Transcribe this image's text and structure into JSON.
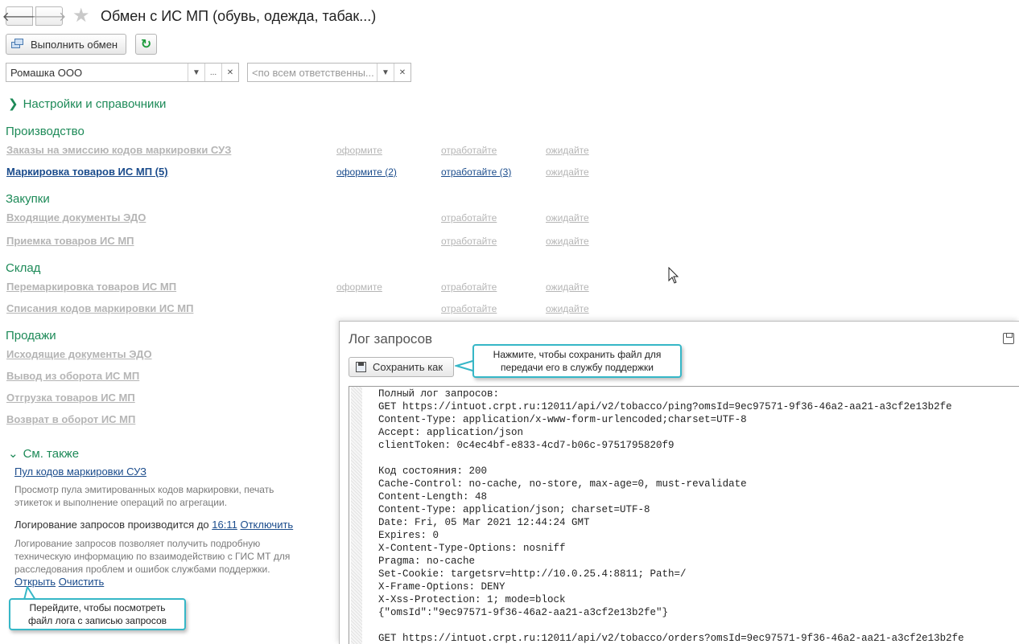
{
  "header": {
    "back_icon": "arrow-left-icon",
    "forward_icon": "arrow-right-icon",
    "favorite_icon": "star-icon",
    "title": "Обмен с ИС МП (обувь, одежда, табак...)"
  },
  "toolbar": {
    "exec_label": "Выполнить обмен",
    "refresh_icon": "refresh-icon"
  },
  "filters": {
    "organization": "Ромашка ООО",
    "responsible_placeholder": "<по всем ответственны...",
    "dots": "..."
  },
  "settings_link": "Настройки и справочники",
  "groups": {
    "production": {
      "title": "Производство",
      "rows": [
        {
          "label": "Заказы на эмиссию кодов маркировки СУЗ",
          "a1": "оформите",
          "a2": "отработайте",
          "a3": "ожидайте"
        },
        {
          "label": "Маркировка товаров ИС МП (5)",
          "a1": "оформите (2)",
          "a2": "отработайте (3)",
          "a3": "ожидайте"
        }
      ]
    },
    "purchases": {
      "title": "Закупки",
      "rows": [
        {
          "label": "Входящие документы ЭДО",
          "a2": "отработайте",
          "a3": "ожидайте"
        },
        {
          "label": "Приемка товаров ИС МП",
          "a2": "отработайте",
          "a3": "ожидайте"
        }
      ]
    },
    "warehouse": {
      "title": "Склад",
      "rows": [
        {
          "label": "Перемаркировка товаров ИС МП",
          "a1": "оформите",
          "a2": "отработайте",
          "a3": "ожидайте"
        },
        {
          "label": "Списания кодов маркировки ИС МП",
          "a2": "отработайте",
          "a3": "ожидайте"
        }
      ]
    },
    "sales": {
      "title": "Продажи",
      "rows": [
        {
          "label": "Исходящие документы ЭДО"
        },
        {
          "label": "Вывод из оборота ИС МП"
        },
        {
          "label": "Отгрузка товаров ИС МП"
        },
        {
          "label": "Возврат в оборот ИС МП"
        }
      ]
    }
  },
  "see_also": {
    "title": "См. также",
    "pool_link": "Пул кодов маркировки СУЗ",
    "pool_desc": [
      "Просмотр пула эмитированных кодов маркировки, печать",
      "этикеток и выполнение операций по агрегации."
    ],
    "logging_text": "Логирование запросов производится до",
    "logging_time": "16:11",
    "disable_link": "Отключить",
    "logging_desc": [
      "Логирование запросов позволяет получить подробную",
      "техническую информацию по взаимодействию с ГИС МТ для",
      "расследования проблем и ошибок службами поддержки."
    ],
    "open_link": "Открыть",
    "clear_link": "Очистить"
  },
  "callouts": {
    "left": [
      "Перейдите, чтобы посмотреть",
      "файл лога с записью запросов"
    ],
    "right": [
      "Нажмите, чтобы сохранить файл для",
      "передачи его в службу поддержки"
    ]
  },
  "log_window": {
    "title": "Лог запросов",
    "save_icon": "floppy-disk-icon",
    "save_as_label": "Сохранить как",
    "lines": [
      "Полный лог запросов:",
      "GET https://intuot.crpt.ru:12011/api/v2/tobacco/ping?omsId=9ec97571-9f36-46a2-aa21-a3cf2e13b2fe",
      "Content-Type: application/x-www-form-urlencoded;charset=UTF-8",
      "Accept: application/json",
      "clientToken: 0c4ec4bf-e833-4cd7-b06c-9751795820f9",
      "",
      "Код состояния: 200",
      "Cache-Control: no-cache, no-store, max-age=0, must-revalidate",
      "Content-Length: 48",
      "Content-Type: application/json; charset=UTF-8",
      "Date: Fri, 05 Mar 2021 12:44:24 GMT",
      "Expires: 0",
      "X-Content-Type-Options: nosniff",
      "Pragma: no-cache",
      "Set-Cookie: targetsrv=http://10.0.25.4:8811; Path=/",
      "X-Frame-Options: DENY",
      "X-Xss-Protection: 1; mode=block",
      "{\"omsId\":\"9ec97571-9f36-46a2-aa21-a3cf2e13b2fe\"}",
      "",
      "GET https://intuot.crpt.ru:12011/api/v2/tobacco/orders?omsId=9ec97571-9f36-46a2-aa21-a3cf2e13b2fe"
    ]
  }
}
